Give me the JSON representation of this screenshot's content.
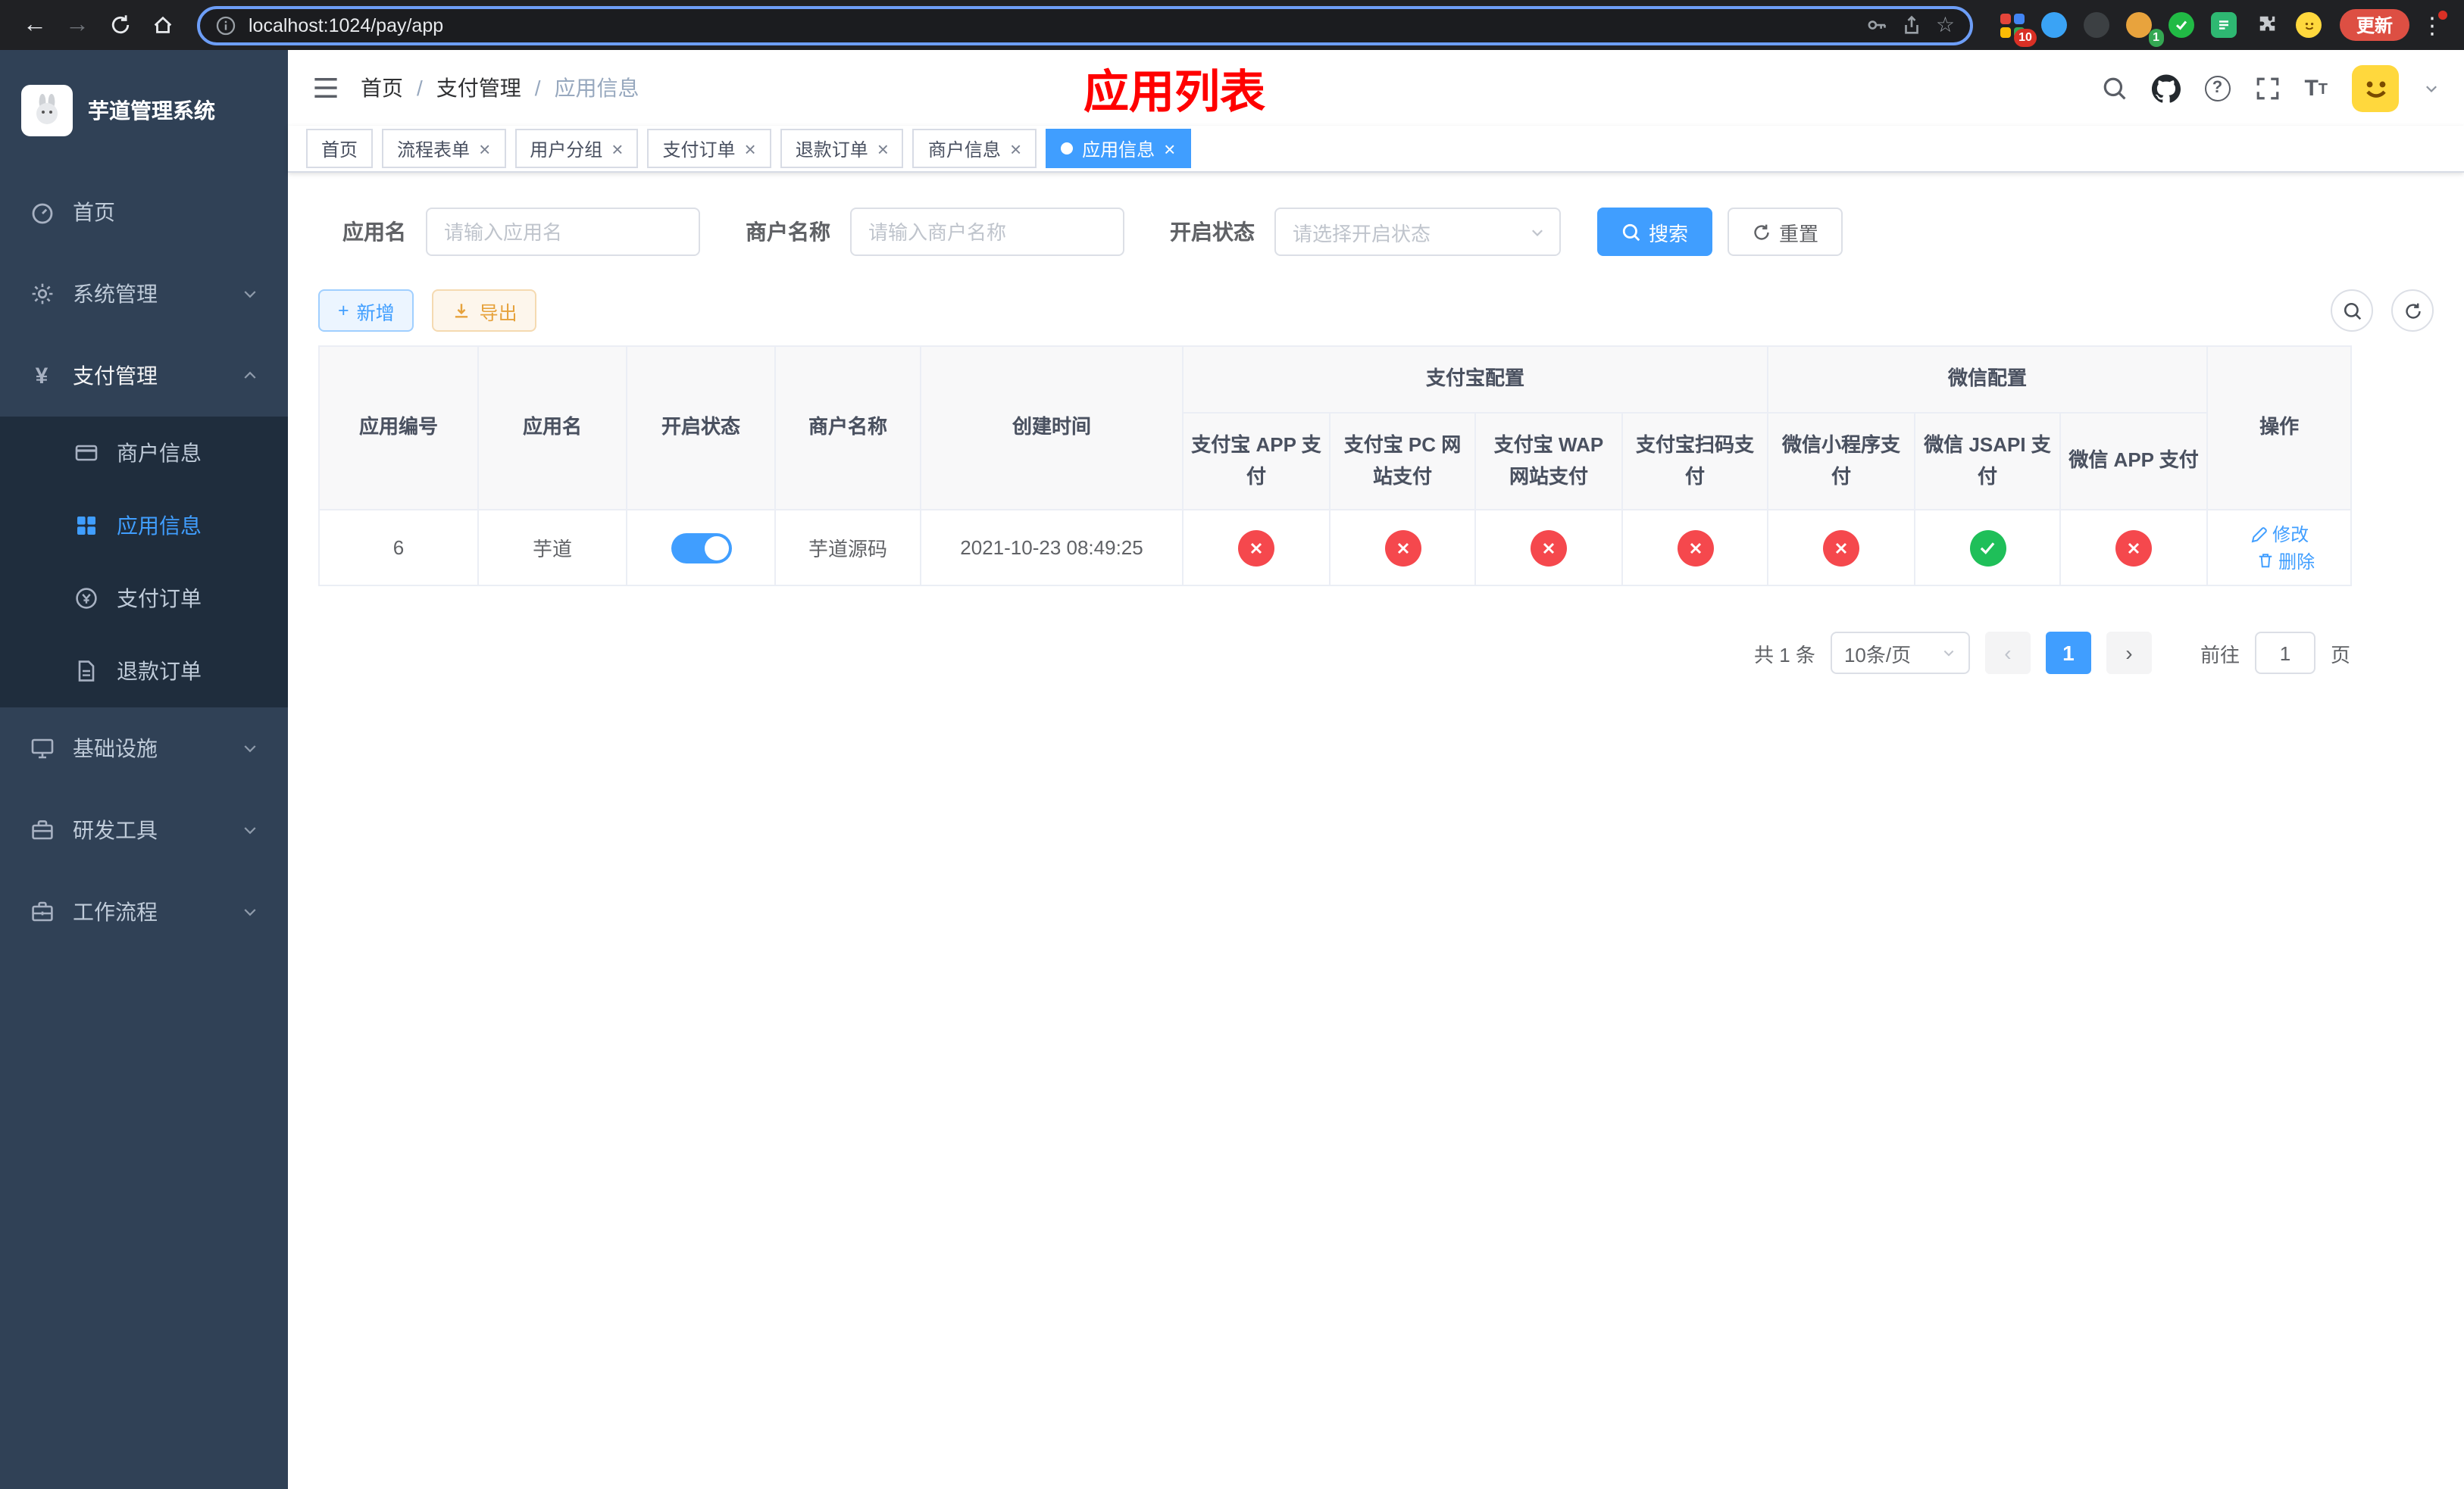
{
  "icons": {
    "close": "×",
    "plus": "+",
    "back": "←",
    "forward": "→",
    "kebab": "⋮",
    "star": "☆",
    "slash": "/",
    "prev": "‹",
    "next": "›",
    "yen": "¥",
    "question": "?"
  },
  "browser": {
    "url": "localhost:1024/pay/app",
    "update_label": "更新",
    "ext_badge_grid": "10",
    "ext_badge_avatar": "1"
  },
  "sidebar": {
    "title": "芋道管理系统",
    "items": [
      {
        "label": "首页"
      },
      {
        "label": "系统管理"
      },
      {
        "label": "支付管理"
      },
      {
        "label": "基础设施"
      },
      {
        "label": "研发工具"
      },
      {
        "label": "工作流程"
      }
    ],
    "submenu": [
      {
        "label": "商户信息"
      },
      {
        "label": "应用信息"
      },
      {
        "label": "支付订单"
      },
      {
        "label": "退款订单"
      }
    ]
  },
  "navbar": {
    "breadcrumb": [
      "首页",
      "支付管理",
      "应用信息"
    ],
    "title": "应用列表"
  },
  "tabs": [
    {
      "label": "首页"
    },
    {
      "label": "流程表单"
    },
    {
      "label": "用户分组"
    },
    {
      "label": "支付订单"
    },
    {
      "label": "退款订单"
    },
    {
      "label": "商户信息"
    },
    {
      "label": "应用信息"
    }
  ],
  "filters": {
    "app_name_label": "应用名",
    "app_name_placeholder": "请输入应用名",
    "merchant_label": "商户名称",
    "merchant_placeholder": "请输入商户名称",
    "status_label": "开启状态",
    "status_placeholder": "请选择开启状态",
    "search_label": "搜索",
    "reset_label": "重置"
  },
  "toolbar": {
    "add_label": "新增",
    "export_label": "导出"
  },
  "table": {
    "groups": {
      "alipay": "支付宝配置",
      "wechat": "微信配置",
      "actions": "操作"
    },
    "columns": {
      "app_id": "应用编号",
      "app_name": "应用名",
      "status": "开启状态",
      "merchant": "商户名称",
      "created": "创建时间",
      "alipay_app": "支付宝 APP 支付",
      "alipay_pc": "支付宝 PC 网站支付",
      "alipay_wap": "支付宝 WAP 网站支付",
      "alipay_qr": "支付宝扫码支付",
      "wx_mini": "微信小程序支付",
      "wx_jsapi": "微信 JSAPI 支付",
      "wx_app": "微信 APP 支付"
    },
    "row": {
      "app_id": "6",
      "app_name": "芋道",
      "status_on": true,
      "merchant": "芋道源码",
      "created": "2021-10-23 08:49:25",
      "pay_status": [
        "no",
        "no",
        "no",
        "no",
        "no",
        "yes",
        "no"
      ],
      "edit_label": "修改",
      "delete_label": "删除"
    }
  },
  "pagination": {
    "total": "共 1 条",
    "page_size": "10条/页",
    "current_page": "1",
    "goto_label": "前往",
    "goto_value": "1",
    "page_unit": "页"
  },
  "colors": {
    "accent": "#409EFF",
    "danger": "#f5484d",
    "success": "#1fbf59",
    "title_red": "#ff0000",
    "sidebar_bg": "#304156",
    "submenu_bg": "#1f2d3d"
  }
}
